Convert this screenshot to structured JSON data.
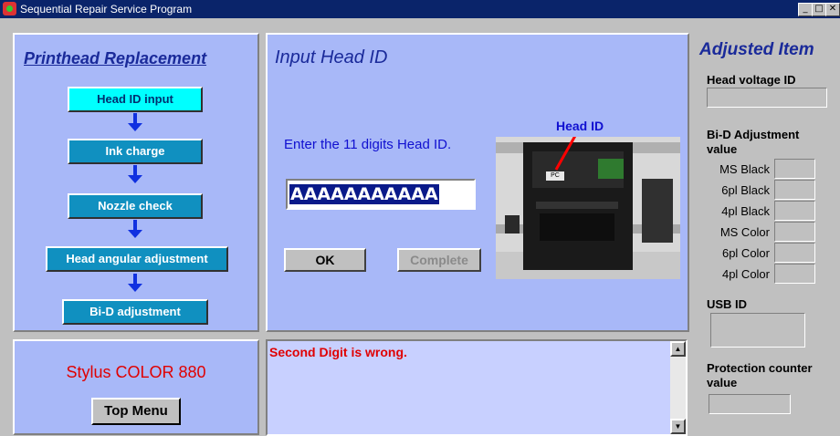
{
  "window": {
    "title": "Sequential Repair Service Program",
    "minimize": "_",
    "restore": "□",
    "close": "✕"
  },
  "left": {
    "heading": "Printhead Replacement",
    "steps": [
      "Head ID input",
      "Ink charge",
      "Nozzle check",
      "Head angular adjustment",
      "Bi-D adjustment"
    ],
    "active_step": 0
  },
  "center": {
    "heading": "Input Head ID",
    "prompt": "Enter the 11 digits Head ID.",
    "head_id_value": "AAAAAAAAAAA",
    "ok_label": "OK",
    "complete_label": "Complete",
    "image_caption": "Head ID",
    "image_tag": "PC"
  },
  "model": {
    "name": "Stylus COLOR 880",
    "top_menu_label": "Top Menu"
  },
  "message": {
    "text": "Second Digit is wrong."
  },
  "right": {
    "heading": "Adjusted Item",
    "head_voltage_label": "Head voltage ID",
    "bid_label_1": "Bi-D Adjustment",
    "bid_label_2": "value",
    "bid_rows": [
      "MS Black",
      "6pl Black",
      "4pl Black",
      "MS Color",
      "6pl Color",
      "4pl Color"
    ],
    "usb_label": "USB ID",
    "protection_label_1": "Protection counter",
    "protection_label_2": "value"
  },
  "colors": {
    "title_bar": "#0a246a",
    "panel_bg": "#a8b8f8",
    "step_bg": "#1090c0",
    "step_active": "#00ffff",
    "heading": "#1a2a9a",
    "model_text": "#e00000",
    "error_text": "#e00000"
  }
}
